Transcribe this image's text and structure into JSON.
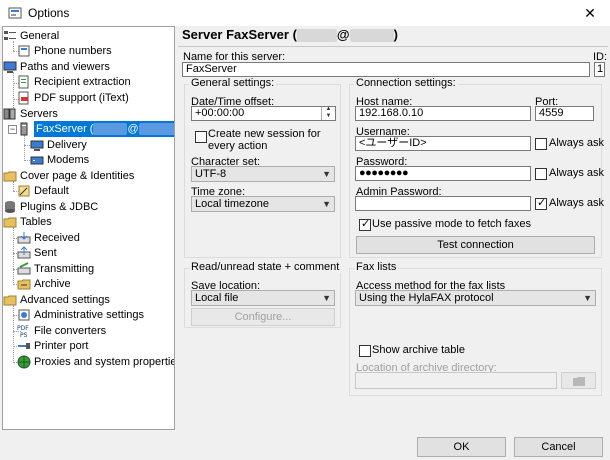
{
  "window": {
    "title": "Options",
    "close_glyph": "✕"
  },
  "tree": {
    "general": "General",
    "phone_numbers": "Phone numbers",
    "paths_and_viewers": "Paths and viewers",
    "recipient_extraction": "Recipient extraction",
    "pdf_support": "PDF support (iText)",
    "servers": "Servers",
    "faxserver": "FaxServer (",
    "faxserver_close": ")",
    "delivery": "Delivery",
    "modems": "Modems",
    "cover_page": "Cover page & Identities",
    "default": "Default",
    "plugins": "Plugins & JDBC",
    "tables": "Tables",
    "received": "Received",
    "sent": "Sent",
    "transmitting": "Transmitting",
    "archive": "Archive",
    "advanced": "Advanced settings",
    "administrative": "Administrative settings",
    "file_converters": "File converters",
    "printer_port": "Printer port",
    "proxies": "Proxies and system properties"
  },
  "header": {
    "title_prefix": "Server FaxServer (",
    "title_at": "@",
    "title_suffix": ")"
  },
  "server": {
    "name_label": "Name for this server:",
    "name_value": "FaxServer",
    "id_label": "ID:",
    "id_value": "1"
  },
  "general": {
    "group_title": "General settings:",
    "datetime_label": "Date/Time offset:",
    "datetime_value": "+00:00:00",
    "new_session_label": "Create new session for every action",
    "charset_label": "Character set:",
    "charset_value": "UTF-8",
    "timezone_label": "Time zone:",
    "timezone_value": "Local timezone"
  },
  "connection": {
    "group_title": "Connection settings:",
    "host_label": "Host name:",
    "host_value": "192.168.0.10",
    "port_label": "Port:",
    "port_value": "4559",
    "username_label": "Username:",
    "username_value": "<ユーザーID>",
    "always_ask": "Always ask",
    "password_label": "Password:",
    "password_value": "●●●●●●●●",
    "admin_password_label": "Admin Password:",
    "admin_always_ask_checked": true,
    "passive_label": "Use passive mode to fetch faxes",
    "passive_checked": true,
    "test_button": "Test connection"
  },
  "read_unread": {
    "group_title": "Read/unread state + comment",
    "save_location_label": "Save location:",
    "save_location_value": "Local file",
    "configure_button": "Configure..."
  },
  "fax_lists": {
    "group_title": "Fax lists",
    "access_label": "Access method for the fax lists",
    "access_value": "Using the HylaFAX protocol",
    "show_archive_label": "Show archive table",
    "archive_dir_label": "Location of archive directory:"
  },
  "buttons": {
    "ok": "OK",
    "cancel": "Cancel"
  },
  "colors": {
    "selection": "#0078d7",
    "panel": "#f0f0f0",
    "border": "#a0a0a0"
  }
}
